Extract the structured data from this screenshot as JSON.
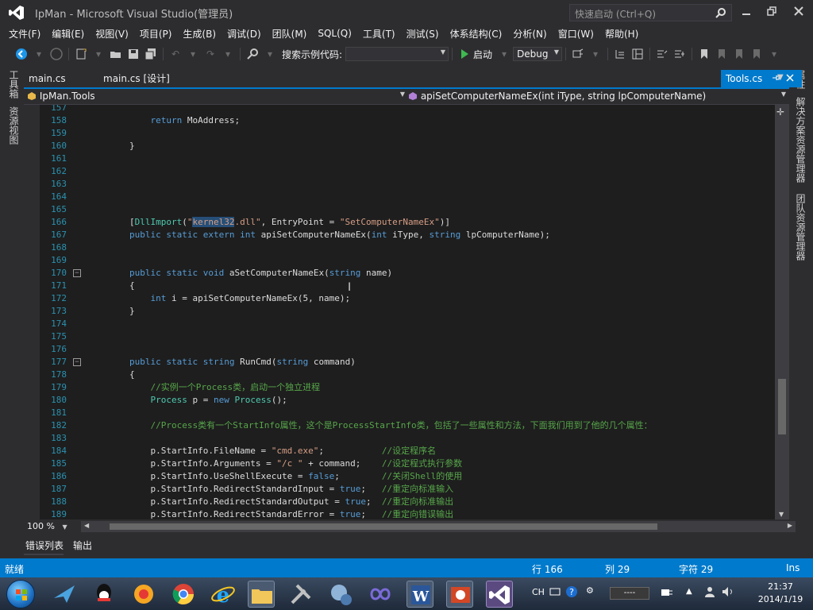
{
  "window": {
    "title": "IpMan - Microsoft Visual Studio(管理员)",
    "quick_launch_placeholder": "快速启动 (Ctrl+Q)"
  },
  "menu": [
    "文件(F)",
    "编辑(E)",
    "视图(V)",
    "项目(P)",
    "生成(B)",
    "调试(D)",
    "团队(M)",
    "SQL(Q)",
    "工具(T)",
    "测试(S)",
    "体系结构(C)",
    "分析(N)",
    "窗口(W)",
    "帮助(H)"
  ],
  "toolbar": {
    "search_label": "搜索示例代码:",
    "start_label": "启动",
    "config_value": "Debug"
  },
  "left_strip": [
    "工具箱",
    "资源视图"
  ],
  "right_strip": [
    "属性",
    "解决方案资源管理器",
    "团队资源管理器"
  ],
  "tabs": {
    "tab1": "main.cs",
    "tab2": "main.cs [设计]",
    "active": "Tools.cs"
  },
  "nav": {
    "left": "IpMan.Tools",
    "right": "apiSetComputerNameEx(int iType, string lpComputerName)"
  },
  "code_lines": [
    {
      "n": "157",
      "t": ""
    },
    {
      "n": "158",
      "t": "            return MoAddress;"
    },
    {
      "n": "159",
      "t": ""
    },
    {
      "n": "160",
      "t": "        }"
    },
    {
      "n": "161",
      "t": ""
    },
    {
      "n": "162",
      "t": ""
    },
    {
      "n": "163",
      "t": ""
    },
    {
      "n": "164",
      "t": ""
    },
    {
      "n": "165",
      "t": ""
    },
    {
      "n": "166",
      "t": "        [DllImport(\"kernel32.dll\", EntryPoint = \"SetComputerNameEx\")]"
    },
    {
      "n": "167",
      "t": "        public static extern int apiSetComputerNameEx(int iType, string lpComputerName);"
    },
    {
      "n": "168",
      "t": ""
    },
    {
      "n": "169",
      "t": ""
    },
    {
      "n": "170",
      "t": "        public static void aSetComputerNameEx(string name)"
    },
    {
      "n": "171",
      "t": "        {"
    },
    {
      "n": "172",
      "t": "            int i = apiSetComputerNameEx(5, name);"
    },
    {
      "n": "173",
      "t": "        }"
    },
    {
      "n": "174",
      "t": ""
    },
    {
      "n": "175",
      "t": ""
    },
    {
      "n": "176",
      "t": ""
    },
    {
      "n": "177",
      "t": "        public static string RunCmd(string command)"
    },
    {
      "n": "178",
      "t": "        {"
    },
    {
      "n": "179",
      "t": "            //实例一个Process类，启动一个独立进程"
    },
    {
      "n": "180",
      "t": "            Process p = new Process();"
    },
    {
      "n": "181",
      "t": ""
    },
    {
      "n": "182",
      "t": "            //Process类有一个StartInfo属性，这个是ProcessStartInfo类，包括了一些属性和方法，下面我们用到了他的几个属性："
    },
    {
      "n": "183",
      "t": ""
    },
    {
      "n": "184",
      "t": "            p.StartInfo.FileName = \"cmd.exe\";           //设定程序名"
    },
    {
      "n": "185",
      "t": "            p.StartInfo.Arguments = \"/c \" + command;    //设定程式执行参数"
    },
    {
      "n": "186",
      "t": "            p.StartInfo.UseShellExecute = false;        //关闭Shell的使用"
    },
    {
      "n": "187",
      "t": "            p.StartInfo.RedirectStandardInput = true;   //重定向标准输入"
    },
    {
      "n": "188",
      "t": "            p.StartInfo.RedirectStandardOutput = true;  //重定向标准输出"
    },
    {
      "n": "189",
      "t": "            p.StartInfo.RedirectStandardError = true;   //重定向错误输出"
    }
  ],
  "zoom": "100 %",
  "output_tabs": [
    "错误列表",
    "输出"
  ],
  "status": {
    "ready": "就绪",
    "line": "行 166",
    "col": "列 29",
    "ch": "字符 29",
    "mode": "Ins"
  },
  "tray": {
    "lang": "CH",
    "ime": "----",
    "time": "21:37",
    "date": "2014/1/19"
  },
  "colors": {
    "accent": "#007acc",
    "editor_bg": "#1e1e1e",
    "keyword": "#569cd6",
    "type": "#4ec9b0",
    "string": "#d69d85",
    "comment": "#57a64a",
    "line_number": "#2b91af"
  }
}
